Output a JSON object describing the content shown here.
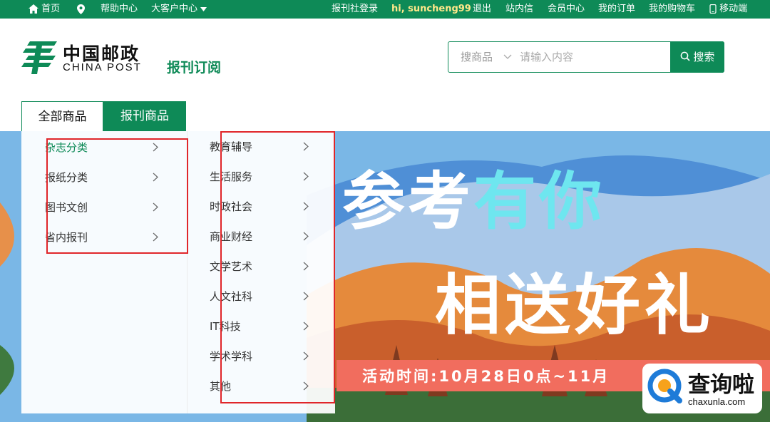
{
  "topbar": {
    "home": "首页",
    "help": "帮助中心",
    "vip": "大客户中心",
    "login": "报刊社登录",
    "greeting": "hi, suncheng99",
    "logout": "退出",
    "messages": "站内信",
    "member": "会员中心",
    "orders": "我的订单",
    "cart": "我的购物车",
    "mobile": "移动端"
  },
  "header": {
    "logo_cn": "中国邮政",
    "logo_en": "CHINA POST",
    "subtitle": "报刊订阅"
  },
  "search": {
    "category": "搜商品",
    "placeholder": "请输入内容",
    "button": "搜索"
  },
  "tabs": [
    "全部商品",
    "报刊商品"
  ],
  "menu": {
    "level1": [
      "杂志分类",
      "报纸分类",
      "图书文创",
      "省内报刊"
    ],
    "level2": [
      "教育辅导",
      "生活服务",
      "时政社会",
      "商业财经",
      "文学艺术",
      "人文社科",
      "IT科技",
      "学术学科",
      "其他"
    ]
  },
  "banner": {
    "line1a": "参考",
    "line1b": "有你",
    "line2": "相送好礼",
    "strip": "活动时间:10月28日0点~11月"
  },
  "watermark": {
    "cn": "查询啦",
    "en": "chaxunla.com"
  },
  "colors": {
    "brand_green": "#0e8a57",
    "highlight_red": "#e0262a",
    "banner_strip": "#f16d5e"
  }
}
